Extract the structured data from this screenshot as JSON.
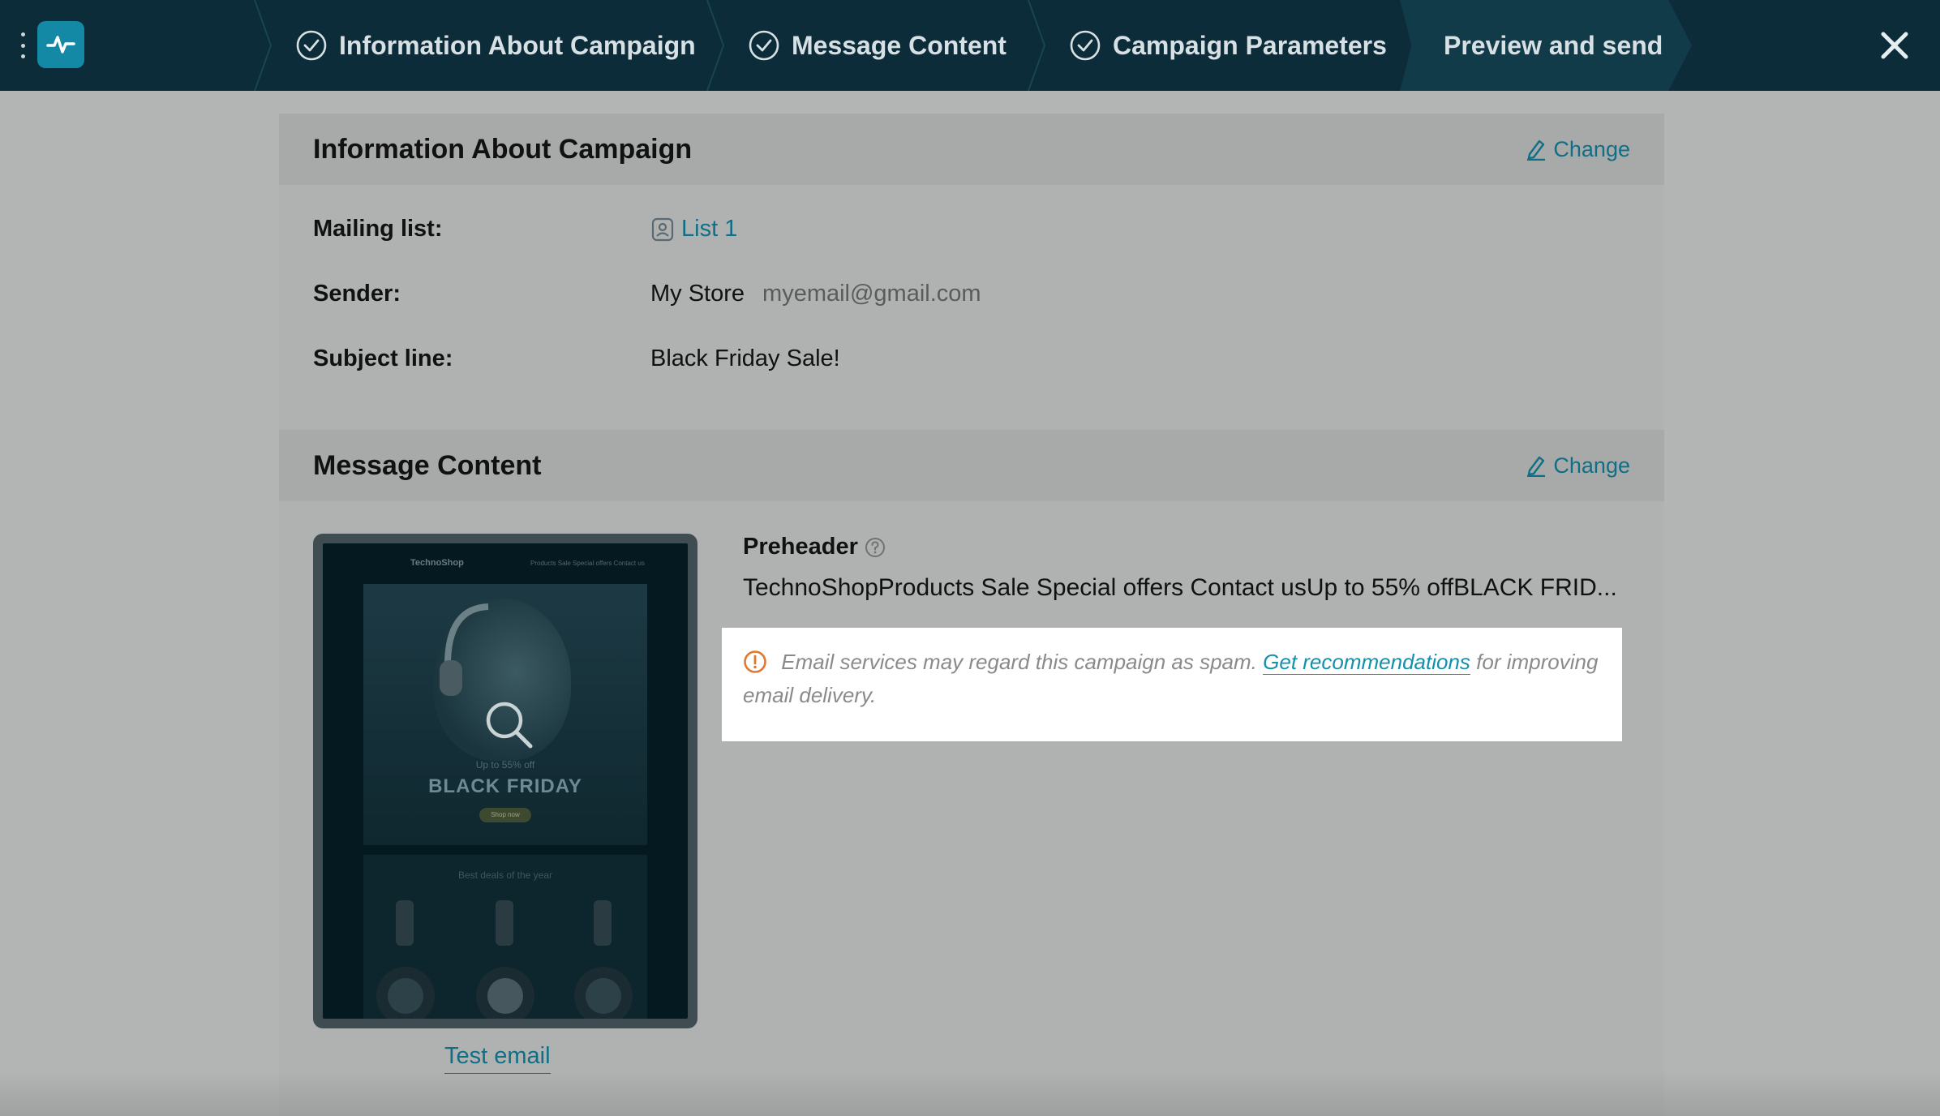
{
  "wizard": {
    "steps": [
      {
        "label": "Information About Campaign",
        "done": true
      },
      {
        "label": "Message Content",
        "done": true
      },
      {
        "label": "Campaign Parameters",
        "done": true
      },
      {
        "label": "Preview and send",
        "done": false,
        "active": true
      }
    ],
    "close_icon": "close-icon",
    "menu_icon": "kebab-icon",
    "logo_icon": "pulse-icon"
  },
  "info_section": {
    "title": "Information About Campaign",
    "change_label": "Change",
    "mailing_list_label": "Mailing list:",
    "mailing_list_value": "List 1",
    "sender_label": "Sender:",
    "sender_name": "My Store",
    "sender_email": "myemail@gmail.com",
    "subject_label": "Subject line:",
    "subject_value": "Black Friday Sale!"
  },
  "content_section": {
    "title": "Message Content",
    "change_label": "Change",
    "preheader_title": "Preheader",
    "preheader_text": "TechnoShopProducts Sale Special offers Contact usUp to 55% offBLACK FRID...",
    "spam_warning": {
      "text_before": "Email services may regard this campaign as spam.",
      "link_text": "Get recommendations",
      "text_after": "for improving email delivery."
    },
    "test_email_label": "Test email",
    "thumbnail": {
      "brand": "TechnoShop",
      "nav": "Products    Sale    Special offers    Contact us",
      "sale_small": "Up to 55% off",
      "sale_big": "BLACK FRIDAY",
      "shop_button": "Shop now",
      "deals_title": "Best deals of the year"
    }
  },
  "colors": {
    "topbar": "#0b2c38",
    "accent": "#1389a6",
    "link": "#0f6f86",
    "warning": "#e2772f"
  }
}
